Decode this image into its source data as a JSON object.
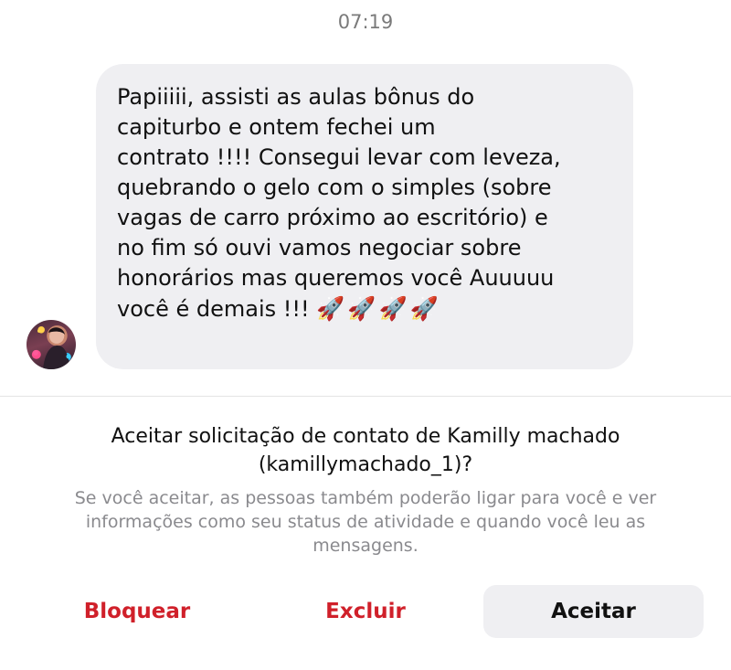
{
  "chat": {
    "timestamp": "07:19",
    "message": {
      "text": "Papiiiii, assisti as aulas bônus do\ncapiturbo e ontem fechei um\ncontrato !!!! Consegui levar com leveza,\nquebrando o gelo com o simples (sobre\nvagas de carro próximo ao escritório) e\nno fim só ouvi vamos negociar sobre\nhonorários mas queremos você Auuuuu\nvocê é demais !!! ",
      "emoji": "🚀🚀🚀🚀"
    },
    "sender_avatar_icon": "avatar-photo"
  },
  "request": {
    "title": "Aceitar solicitação de contato de Kamilly machado\n(kamillymachado_1)?",
    "description": "Se você aceitar, as pessoas também poderão ligar para você e ver informações como seu status de atividade e quando você leu as mensagens."
  },
  "actions": {
    "block_label": "Bloquear",
    "delete_label": "Excluir",
    "accept_label": "Aceitar"
  },
  "colors": {
    "danger": "#d0202a",
    "bubble": "#efeff2",
    "secondary_text": "#8a8a8e"
  }
}
